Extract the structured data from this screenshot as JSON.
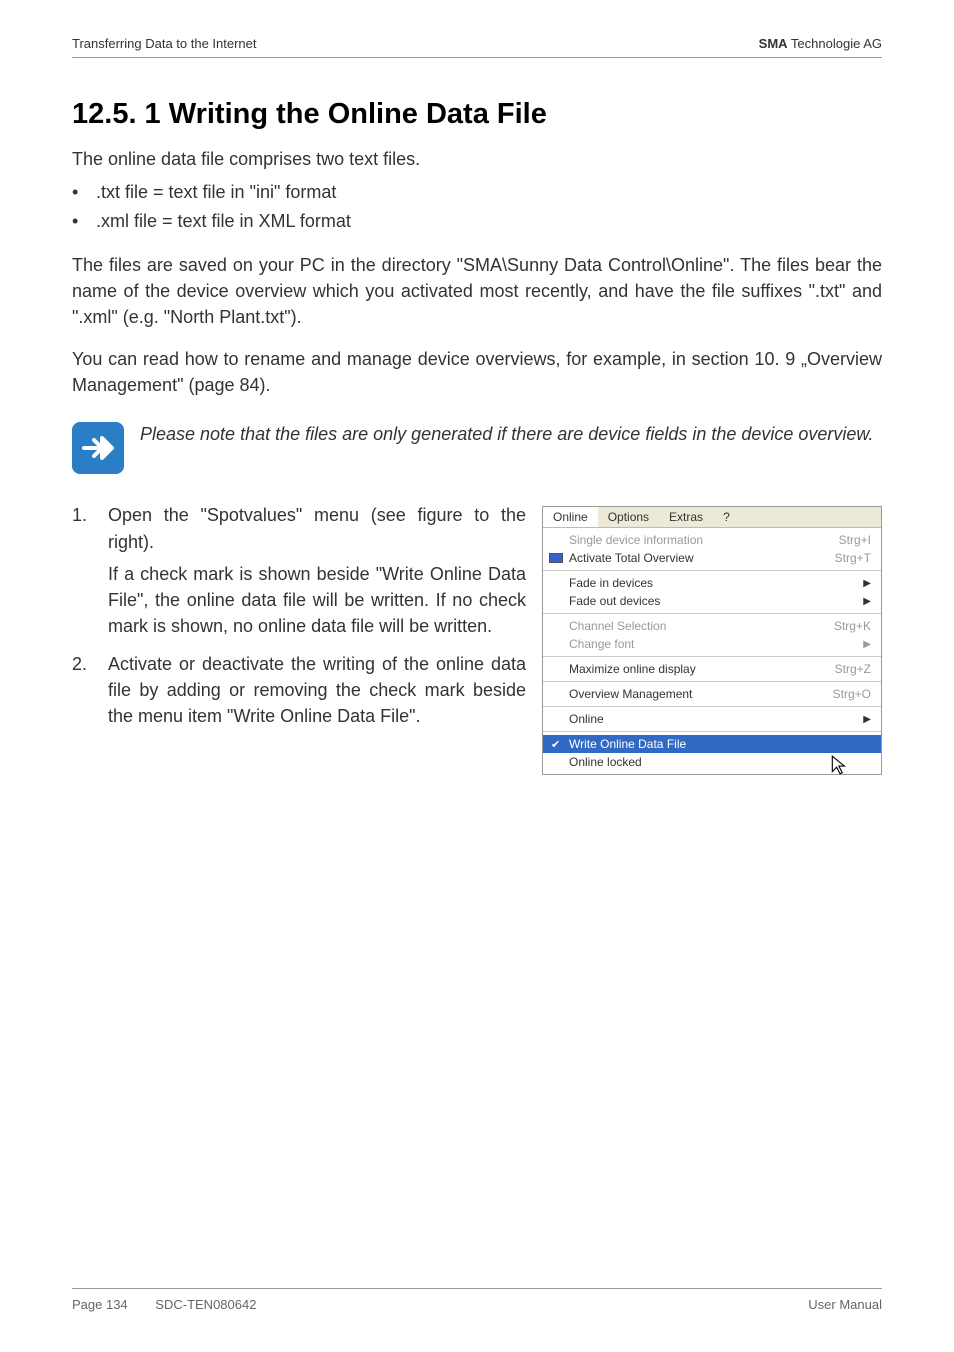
{
  "header": {
    "left": "Transferring Data to the Internet",
    "right_bold": "SMA",
    "right_rest": " Technologie AG"
  },
  "title": "12.5. 1 Writing the Online Data File",
  "intro": "The online data file comprises two text files.",
  "bullets": [
    ".txt file = text file in \"ini\" format",
    ".xml file = text file in XML format"
  ],
  "para1": "The files are saved on your PC in the directory \"SMA\\Sunny Data Control\\Online\". The files bear the name of the device overview which you activated most recently, and have the file suffixes \".txt\" and \".xml\" (e.g. \"North Plant.txt\").",
  "para2": "You can read how to rename and manage device overviews, for example, in section 10. 9 „Overview Management\" (page 84).",
  "note": "Please note that the files are only generated if there are device fields in the device overview.",
  "steps": [
    {
      "main": "Open the \"Spotvalues\" menu (see figure to the right).",
      "sub": "If a check mark is shown beside \"Write Online Data File\", the online data file will be written. If no check mark is shown, no online data file will be written."
    },
    {
      "main": "Activate or deactivate the writing of the online data file by adding or removing the check mark beside the menu item \"Write Online Data File\".",
      "sub": ""
    }
  ],
  "menu": {
    "tabs": [
      "Online",
      "Options",
      "Extras",
      "?"
    ],
    "section1": [
      {
        "label": "Single device information",
        "shortcut": "Strg+I",
        "disabled": true
      },
      {
        "label": "Activate Total Overview",
        "shortcut": "Strg+T",
        "icon": true
      }
    ],
    "section2": [
      {
        "label": "Fade in devices",
        "arrow": true
      },
      {
        "label": "Fade out devices",
        "arrow": true
      }
    ],
    "section3": [
      {
        "label": "Channel Selection",
        "shortcut": "Strg+K",
        "disabled": true
      },
      {
        "label": "Change font",
        "arrow": true,
        "disabled": true
      }
    ],
    "section4": [
      {
        "label": "Maximize online display",
        "shortcut": "Strg+Z"
      }
    ],
    "section5": [
      {
        "label": "Overview Management",
        "shortcut": "Strg+O"
      }
    ],
    "section6": [
      {
        "label": "Online",
        "arrow": true
      }
    ],
    "section7": [
      {
        "label": "Write Online Data File",
        "highlighted": true,
        "check": true
      },
      {
        "label": "Online locked"
      }
    ]
  },
  "footer": {
    "page": "Page 134",
    "code": "SDC-TEN080642",
    "right": "User Manual"
  }
}
